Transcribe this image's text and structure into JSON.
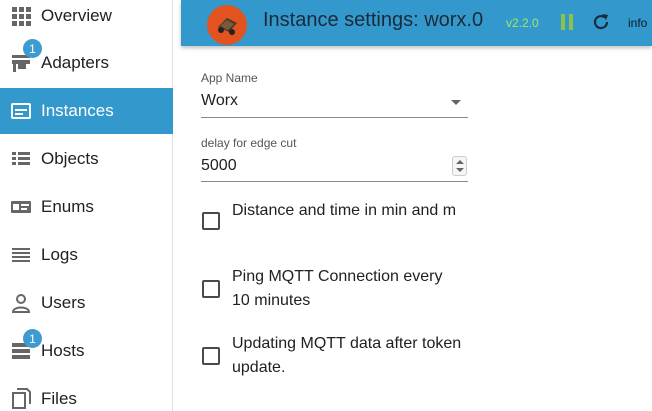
{
  "sidebar": {
    "items": [
      {
        "label": "Overview",
        "icon": "grid-icon"
      },
      {
        "label": "Adapters",
        "icon": "store-icon",
        "badge": "1"
      },
      {
        "label": "Instances",
        "icon": "instances-icon",
        "active": true
      },
      {
        "label": "Objects",
        "icon": "list-icon"
      },
      {
        "label": "Enums",
        "icon": "enums-icon"
      },
      {
        "label": "Logs",
        "icon": "logs-icon"
      },
      {
        "label": "Users",
        "icon": "user-icon"
      },
      {
        "label": "Hosts",
        "icon": "hosts-icon",
        "badge": "1"
      },
      {
        "label": "Files",
        "icon": "files-icon"
      }
    ]
  },
  "header": {
    "title": "Instance settings: worx.0",
    "version": "v2.2.0",
    "info_label": "info",
    "colors": {
      "bar": "#3399cc",
      "version": "#9ee86a",
      "pause": "#8bc34a",
      "logo": "#e2531f"
    }
  },
  "form": {
    "app_name": {
      "label": "App Name",
      "value": "Worx"
    },
    "delay": {
      "label": "delay for edge cut",
      "value": "5000"
    },
    "checkboxes": [
      {
        "label": "Distance and time in min and m",
        "checked": false
      },
      {
        "label": "Ping MQTT Connection every 10 minutes",
        "checked": false
      },
      {
        "label": "Updating MQTT data after token update.",
        "checked": false
      }
    ]
  }
}
